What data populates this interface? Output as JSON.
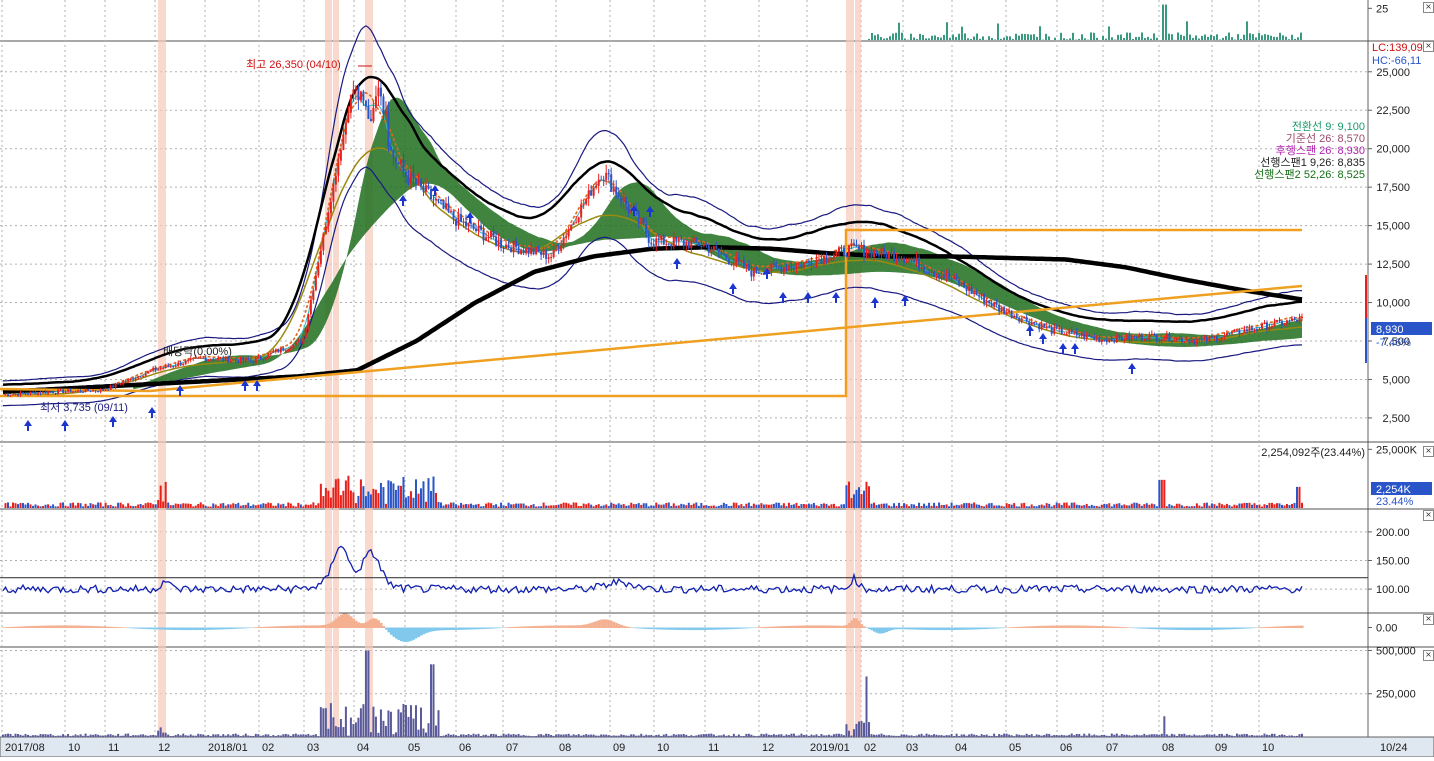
{
  "colors": {
    "up": "#e8201a",
    "down": "#2a55c8",
    "grid": "#b0b0b0",
    "axis_bg": "#dfe7f0",
    "cloud": "#1f6e1f",
    "ma_black": "#000000",
    "ma_orange": "#f0a020",
    "bollinger": "#1a1a80",
    "price_tag": "#2a55c8",
    "highlight": "#f7c9b8"
  },
  "chart_data": [
    {
      "type": "bar",
      "panel": "top-volume",
      "y_tick_labels": [
        "25"
      ],
      "ylim": [
        0,
        30
      ]
    },
    {
      "type": "line",
      "panel": "price",
      "annotations": {
        "high_label": "최고 26,350 (04/10)",
        "dividend_label": "배당락(0.00%)",
        "low_label": "최저 3,735 (09/11)",
        "lc_label": "LC:139,09",
        "hc_label": "HC:-66,11"
      },
      "legend": [
        {
          "text": "전환선 9: 9,100",
          "color": "#1a9a6a"
        },
        {
          "text": "기준선 26: 8,570",
          "color": "#9a4a6a"
        },
        {
          "text": "후행스팬 26: 8,930",
          "color": "#b020b0"
        },
        {
          "text": "선행스팬1 9,26: 8,835",
          "color": "#222222"
        },
        {
          "text": "선행스팬2 52,26: 8,525",
          "color": "#157015"
        }
      ],
      "y_tick_labels": [
        "2,500",
        "5,000",
        "7,500",
        "10,000",
        "12,500",
        "15,000",
        "17,500",
        "20,000",
        "22,500",
        "25,000"
      ],
      "y_ticks": [
        2500,
        5000,
        7500,
        10000,
        12500,
        15000,
        17500,
        20000,
        22500,
        25000
      ],
      "ylim": [
        1000,
        27000
      ],
      "current_price": "8,930",
      "current_change": "-7.46%",
      "x": [
        "2017/08",
        "10",
        "11",
        "12",
        "2018/01",
        "02",
        "03",
        "04",
        "05",
        "06",
        "07",
        "08",
        "09",
        "10",
        "11",
        "12",
        "2019/01",
        "02",
        "03",
        "04",
        "05",
        "06",
        "07",
        "08",
        "09",
        "10"
      ],
      "close": [
        4000,
        4200,
        4300,
        5600,
        6400,
        6200,
        7500,
        24000,
        18500,
        15500,
        13800,
        13000,
        18500,
        14000,
        13800,
        12000,
        12500,
        13500,
        13000,
        11500,
        9500,
        8200,
        7600,
        7800,
        7500,
        8300,
        8930
      ],
      "ma_long": [
        4200,
        4400,
        4600,
        4800,
        5000,
        5200,
        5600,
        7500,
        10000,
        12000,
        13000,
        13500,
        13600,
        13500,
        13200,
        13000,
        13000,
        12900,
        12800,
        12300,
        11500,
        10800,
        10200
      ]
    },
    {
      "type": "bar",
      "panel": "volume",
      "label": "2,254,092주(23.44%)",
      "y_tick_labels": [
        "25,000K"
      ],
      "tag_value": "2,254K",
      "tag_pct": "23.44%",
      "ylim": [
        0,
        26000
      ]
    },
    {
      "type": "line",
      "panel": "oscillator",
      "y_tick_labels": [
        "100.00",
        "150.00",
        "200.00"
      ],
      "ylim": [
        60,
        240
      ],
      "reference": 120
    },
    {
      "type": "area",
      "panel": "histogram",
      "y_tick_labels": [
        "0.00"
      ],
      "ylim": [
        -1,
        1
      ]
    },
    {
      "type": "bar",
      "panel": "bottom-volume",
      "y_tick_labels": [
        "250,000",
        "500,000"
      ],
      "ylim": [
        0,
        520000
      ]
    }
  ],
  "x_axis": {
    "labels": [
      "2017/08",
      "10",
      "11",
      "12",
      "2018/01",
      "02",
      "03",
      "04",
      "05",
      "06",
      "07",
      "08",
      "09",
      "10",
      "11",
      "12",
      "2019/01",
      "02",
      "03",
      "04",
      "05",
      "06",
      "07",
      "08",
      "09",
      "10"
    ],
    "date_label": "10/24"
  }
}
